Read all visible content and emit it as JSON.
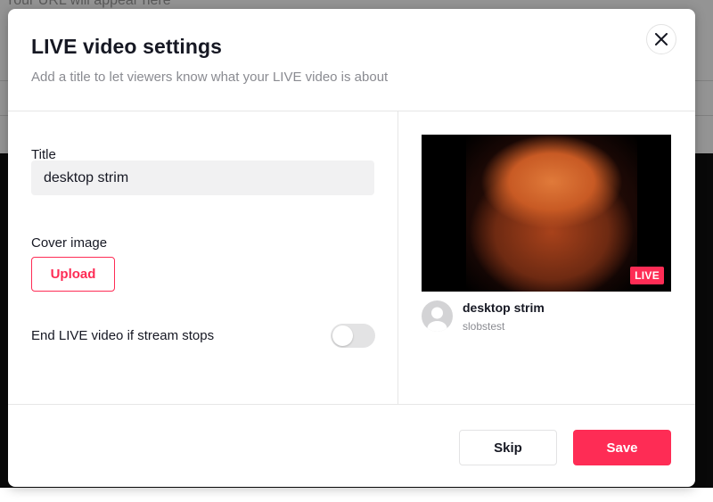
{
  "background": {
    "partial_text": "Your URL will appear here"
  },
  "modal": {
    "title": "LIVE video settings",
    "subtitle": "Add a title to let viewers know what your LIVE video is about",
    "close_icon": "close-icon"
  },
  "form": {
    "title_label": "Title",
    "title_value": "desktop strim",
    "cover_label": "Cover image",
    "upload_label": "Upload",
    "end_live_label": "End LIVE video if stream stops",
    "end_live_enabled": false
  },
  "preview": {
    "live_badge": "LIVE",
    "stream_title": "desktop strim",
    "username": "slobstest"
  },
  "footer": {
    "skip_label": "Skip",
    "save_label": "Save"
  },
  "colors": {
    "accent": "#fe2c55",
    "text_primary": "#161823",
    "text_secondary": "#8a8b91"
  }
}
